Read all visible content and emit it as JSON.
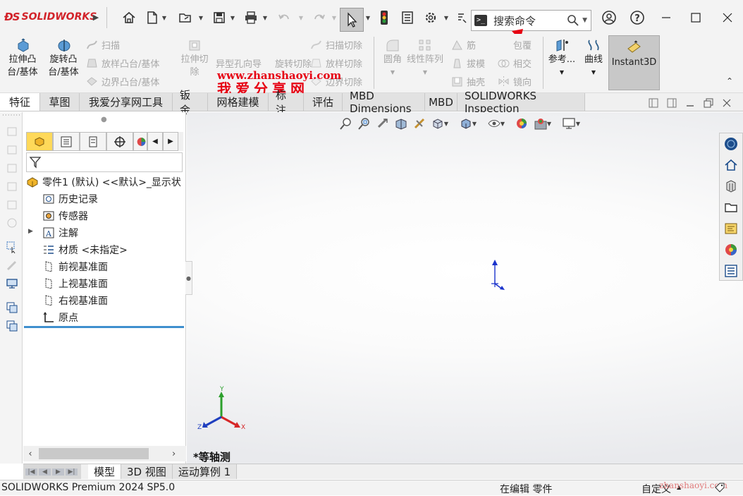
{
  "app": {
    "logo_text": "SOLIDWORKS",
    "product": "SOLIDWORKS Premium 2024 SP5.0"
  },
  "search": {
    "placeholder": "搜索命令",
    "prompt_icon": ">_"
  },
  "watermark": {
    "title": "我爱分享网",
    "url": "www.zhanshaoyi.com",
    "corner": "zhanshaoyi.com"
  },
  "toolbar": {
    "extrude_boss": "拉伸凸台/基体",
    "revolve_boss": "旋转凸台/基体",
    "sweep": "扫描",
    "loft": "放样凸台/基体",
    "boundary_boss": "边界凸台/基体",
    "extrude_cut": "拉伸切除",
    "hole_wizard": "异型孔向导",
    "revolve_cut": "旋转切除",
    "sweep_cut": "扫描切除",
    "loft_cut": "放样切除",
    "boundary_cut": "边界切除",
    "fillet": "圆角",
    "linear_pattern": "线性阵列",
    "rib": "筋",
    "draft": "拔模",
    "shell": "抽壳",
    "wrap": "包覆",
    "intersect": "相交",
    "mirror": "镜向",
    "reference": "参考...",
    "curves": "曲线",
    "instant3d": "Instant3D"
  },
  "tabs": [
    {
      "label": "特征",
      "active": true
    },
    {
      "label": "草图"
    },
    {
      "label": "我爱分享网工具"
    },
    {
      "label": "钣金"
    },
    {
      "label": "网格建模"
    },
    {
      "label": "标注"
    },
    {
      "label": "评估"
    },
    {
      "label": "MBD Dimensions"
    },
    {
      "label": "MBD"
    },
    {
      "label": "SOLIDWORKS Inspection"
    }
  ],
  "tree": {
    "root": "零件1 (默认) <<默认>_显示状",
    "items": [
      {
        "label": "历史记录",
        "icon": "history-icon"
      },
      {
        "label": "传感器",
        "icon": "sensor-icon"
      },
      {
        "label": "注解",
        "icon": "annotation-icon"
      },
      {
        "label": "材质 <未指定>",
        "icon": "material-icon"
      },
      {
        "label": "前视基准面",
        "icon": "plane-icon"
      },
      {
        "label": "上视基准面",
        "icon": "plane-icon"
      },
      {
        "label": "右视基准面",
        "icon": "plane-icon"
      },
      {
        "label": "原点",
        "icon": "origin-icon"
      }
    ]
  },
  "graphics": {
    "view_label": "*等轴测",
    "triad": {
      "x": "X",
      "y": "Y",
      "z": "Z"
    }
  },
  "bottom_tabs": [
    {
      "label": "模型",
      "active": true
    },
    {
      "label": "3D 视图"
    },
    {
      "label": "运动算例 1"
    }
  ],
  "status": {
    "left": "SOLIDWORKS Premium 2024 SP5.0",
    "mode": "在编辑 零件",
    "custom": "自定义"
  },
  "colors": {
    "brand_red": "#d2232a",
    "watermark_red": "#e60012",
    "tree_accent": "#3f8fce",
    "instant3d_active": "#c8c8c8"
  }
}
